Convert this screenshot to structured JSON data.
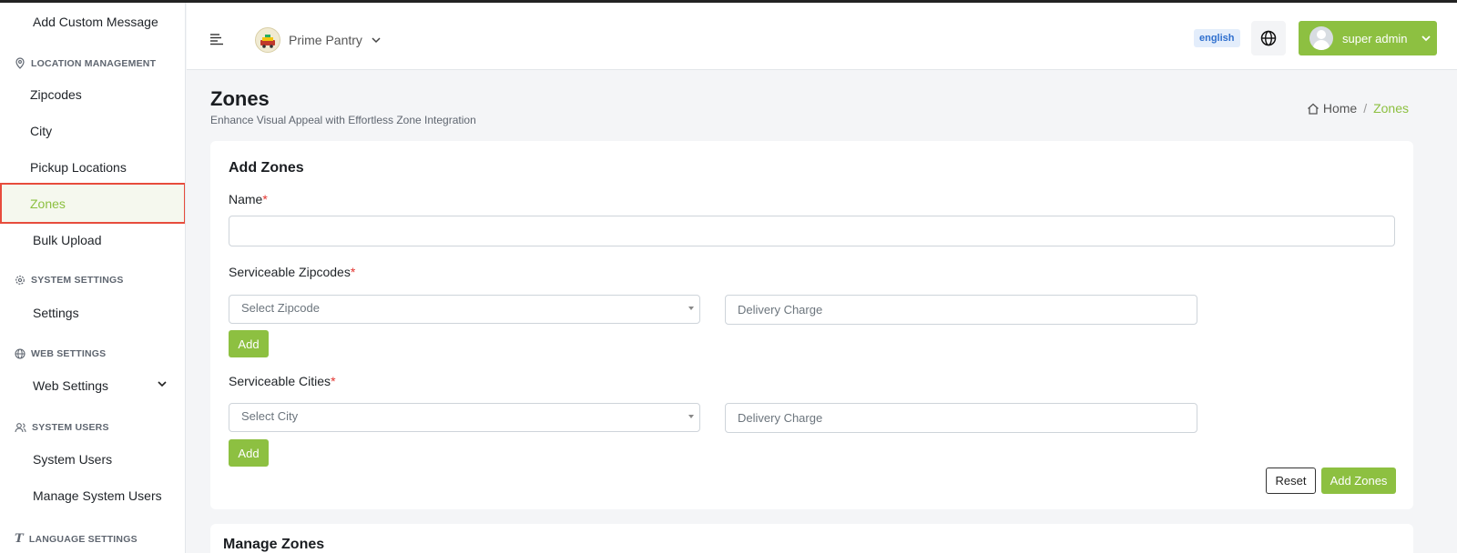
{
  "sidebar": {
    "add_custom_message": "Add Custom Message",
    "location_heading": "LOCATION MANAGEMENT",
    "zipcodes": "Zipcodes",
    "city": "City",
    "pickup_locations": "Pickup Locations",
    "zones": "Zones",
    "bulk_upload": "Bulk Upload",
    "system_settings_heading": "SYSTEM SETTINGS",
    "settings": "Settings",
    "web_settings_heading": "WEB SETTINGS",
    "web_settings": "Web Settings",
    "system_users_heading": "SYSTEM USERS",
    "system_users": "System Users",
    "manage_system_users": "Manage System Users",
    "language_settings_heading": "LANGUAGE SETTINGS"
  },
  "header": {
    "store_name": "Prime Pantry",
    "language_badge": "english",
    "user_name": "super admin"
  },
  "page": {
    "title": "Zones",
    "subtitle": "Enhance Visual Appeal with Effortless Zone Integration",
    "breadcrumb_home": "Home",
    "breadcrumb_sep": "/",
    "breadcrumb_current": "Zones"
  },
  "form": {
    "title": "Add Zones",
    "name_label": "Name",
    "required_mark": "*",
    "zipcodes_label": "Serviceable Zipcodes",
    "zipcode_select": "Select Zipcode",
    "delivery_charge_placeholder": "Delivery Charge",
    "add_label": "Add",
    "cities_label": "Serviceable Cities",
    "city_select": "Select City",
    "reset_label": "Reset",
    "submit_label": "Add Zones"
  },
  "manage_card": {
    "title": "Manage Zones"
  },
  "colors": {
    "accent": "#8dc041",
    "active_outline": "#e74c3c",
    "required": "#e3342f"
  }
}
